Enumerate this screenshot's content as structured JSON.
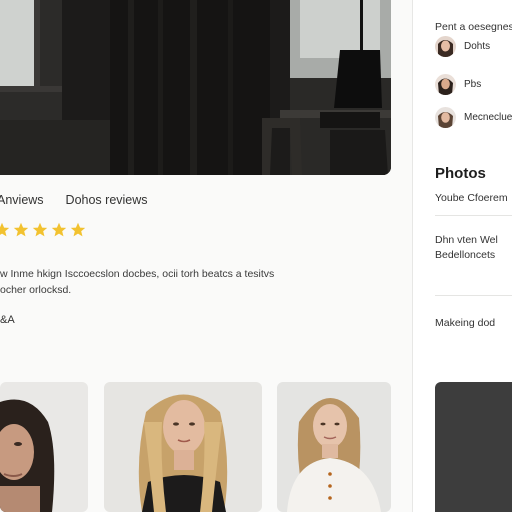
{
  "tabs": [
    {
      "label": "Anviews"
    },
    {
      "label": "Dohos reviews"
    }
  ],
  "rating": {
    "stars": 5,
    "color": "#f2c230"
  },
  "description": {
    "line1": "w Inme hkign Isccoecslon docbes, ocii torh beatcs a tesitvs",
    "line2": "ocher orlocksd."
  },
  "qa_label": "&A",
  "sidebar": {
    "header": "Pent a oesegnes",
    "people": [
      {
        "name": "Dohts"
      },
      {
        "name": "Pbs"
      },
      {
        "name": "Mecneclue"
      }
    ],
    "photos_title": "Photos",
    "photos_line": "Yoube Cfoerem",
    "body_line1": "Dhn vten Wel",
    "body_line2": "Bedelloncets",
    "marketing": "Makeing dod"
  },
  "colors": {
    "accent_star": "#f2c230",
    "dark_card": "#3d3d3d"
  }
}
